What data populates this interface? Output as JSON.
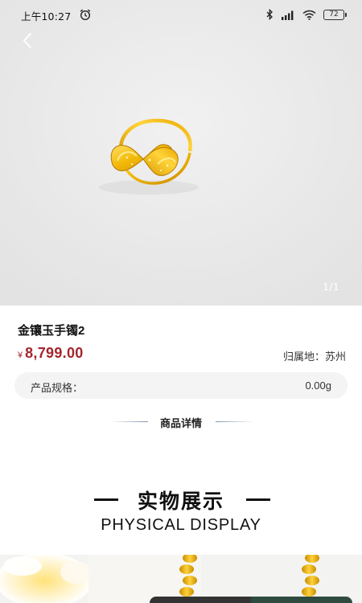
{
  "status_bar": {
    "time": "上午10:27",
    "battery": "72",
    "icons": [
      "alarm-icon",
      "bluetooth-icon",
      "signal-icon",
      "wifi-icon",
      "battery-icon"
    ]
  },
  "gallery": {
    "counter": "1/1",
    "back_icon": "chevron-left-icon"
  },
  "product": {
    "title": "金镶玉手镯2",
    "currency": "¥",
    "price": "8,799.00",
    "location": "归属地：苏州",
    "spec_label": "产品规格：",
    "spec_value": "0.00g",
    "price_color": "#a4262c"
  },
  "details": {
    "section_title": "商品详情",
    "display_title_cn": "实物展示",
    "display_title_en": "PHYSICAL DISPLAY"
  }
}
